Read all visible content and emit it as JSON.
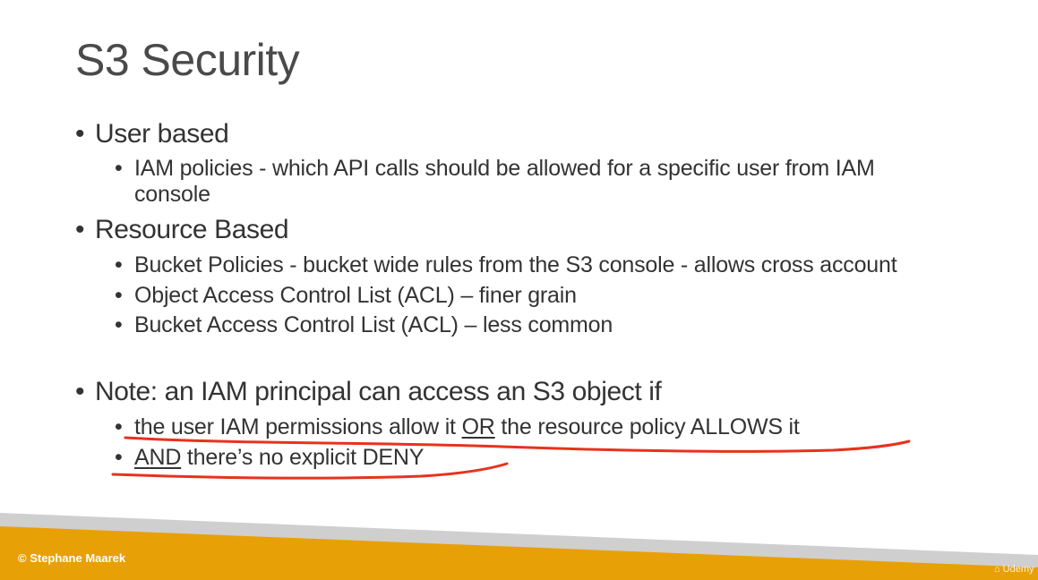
{
  "slide": {
    "title": "S3 Security",
    "sections": [
      {
        "heading": "User based",
        "items": [
          {
            "line1": "IAM policies - which API calls should be allowed for a specific user from IAM",
            "line2": "console"
          }
        ]
      },
      {
        "heading": "Resource Based",
        "items": [
          {
            "text": "Bucket Policies - bucket wide rules from the S3 console - allows cross account"
          },
          {
            "text": "Object Access Control List (ACL) – finer grain"
          },
          {
            "text": "Bucket Access Control List (ACL) – less common"
          }
        ]
      }
    ],
    "note": {
      "label": "Note:",
      "text": " an IAM principal can access an S3 object if",
      "items": [
        {
          "part1": "the user IAM permissions allow it ",
          "underlined": "OR",
          "part2": " the resource policy ALLOWS it"
        },
        {
          "underlined": "AND",
          "part2": " there’s no explicit DENY"
        }
      ]
    }
  },
  "footer": {
    "copyright": "© Stephane Maarek",
    "brand": "Udemy"
  },
  "colors": {
    "title": "#4a4a4a",
    "text": "#333333",
    "footer_orange": "#e8a007",
    "footer_gray": "#cfcfcf",
    "annotation_red": "#e8321c"
  },
  "bullet_glyph": "•"
}
